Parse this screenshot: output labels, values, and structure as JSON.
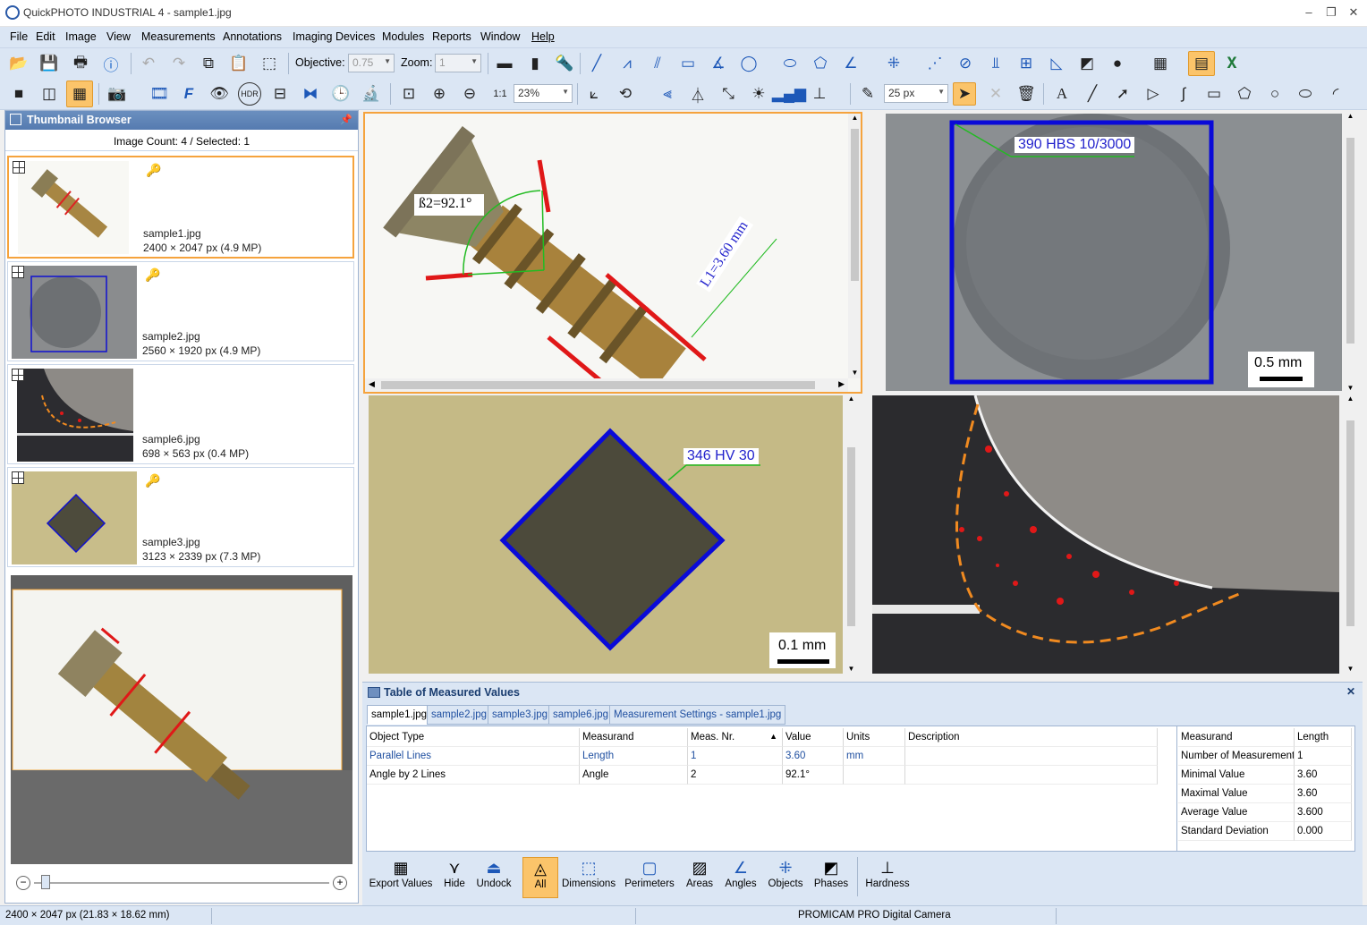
{
  "window": {
    "title": "QuickPHOTO INDUSTRIAL 4 - sample1.jpg"
  },
  "menu": [
    "File",
    "Edit",
    "Image",
    "View",
    "Measurements",
    "Annotations",
    "Imaging Devices",
    "Modules",
    "Reports",
    "Window",
    "Help"
  ],
  "toolbar": {
    "objective_label": "Objective:",
    "objective_value": "0.75",
    "zoom_label": "Zoom:",
    "zoom_value": "1",
    "zoom_percent": "23%",
    "line_width": "25 px"
  },
  "thumbnail_browser": {
    "title": "Thumbnail Browser",
    "count_text": "Image Count: 4 / Selected: 1",
    "items": [
      {
        "name": "sample1.jpg",
        "info": "2400 × 2047 px (4.9 MP)"
      },
      {
        "name": "sample2.jpg",
        "info": "2560 × 1920 px (4.9 MP)"
      },
      {
        "name": "sample6.jpg",
        "info": "698 × 563 px (0.4 MP)"
      },
      {
        "name": "sample3.jpg",
        "info": "3123 × 2339 px (7.3 MP)"
      }
    ]
  },
  "views": {
    "screw": {
      "angle_label": "ß2=92.1°",
      "length_label": "L1=3.60 mm"
    },
    "hbs": {
      "label": "390 HBS 10/3000",
      "scale": "0.5 mm"
    },
    "hv": {
      "label": "346 HV 30",
      "scale": "0.1 mm"
    }
  },
  "table": {
    "title": "Table of Measured Values",
    "tabs": [
      "sample1.jpg",
      "sample2.jpg",
      "sample3.jpg",
      "sample6.jpg",
      "Measurement Settings - sample1.jpg"
    ],
    "columns": [
      "Object Type",
      "Measurand",
      "Meas. Nr.",
      "Value",
      "Units",
      "Description"
    ],
    "rows": [
      [
        "Parallel Lines",
        "Length",
        "1",
        "3.60",
        "mm",
        ""
      ],
      [
        "Angle by 2 Lines",
        "Angle",
        "2",
        "92.1°",
        "",
        ""
      ]
    ],
    "stats_header": [
      "Measurand",
      "Length"
    ],
    "stats": [
      [
        "Number of Measurements",
        "1"
      ],
      [
        "Minimal Value",
        "3.60"
      ],
      [
        "Maximal Value",
        "3.60"
      ],
      [
        "Average Value",
        "3.600"
      ],
      [
        "Standard Deviation",
        "0.000"
      ]
    ]
  },
  "bottom_buttons": [
    "Export Values",
    "Hide",
    "Undock",
    "All",
    "Dimensions",
    "Perimeters",
    "Areas",
    "Angles",
    "Objects",
    "Phases",
    "Hardness"
  ],
  "status": {
    "size": "2400 × 2047 px (21.83 × 18.62 mm)",
    "camera": "PROMICAM PRO Digital Camera"
  }
}
